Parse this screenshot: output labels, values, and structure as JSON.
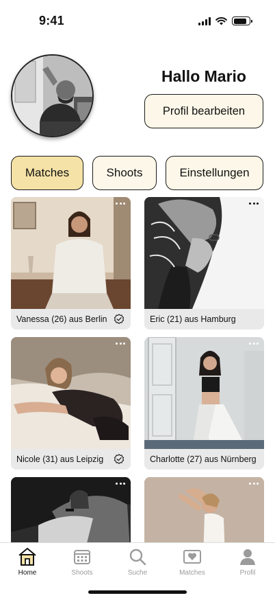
{
  "status_bar": {
    "time": "9:41",
    "battery_level": 0.85
  },
  "profile": {
    "greeting": "Hallo Mario",
    "edit_label": "Profil bearbeiten",
    "avatar_icon": "profile-photo"
  },
  "tabs": [
    {
      "label": "Matches",
      "active": true
    },
    {
      "label": "Shoots",
      "active": false
    },
    {
      "label": "Einstellungen",
      "active": false
    }
  ],
  "cards": [
    {
      "caption": "Vanessa (26) aus Berlin",
      "verified": true,
      "photo": "color"
    },
    {
      "caption": "Eric (21) aus Hamburg",
      "verified": false,
      "photo": "bw"
    },
    {
      "caption": "Nicole (31) aus Leipzig",
      "verified": true,
      "photo": "color"
    },
    {
      "caption": "Charlotte (27) aus Nürnberg",
      "verified": false,
      "photo": "color"
    },
    {
      "caption": "",
      "verified": false,
      "photo": "bw"
    },
    {
      "caption": "",
      "verified": false,
      "photo": "color"
    }
  ],
  "nav": [
    {
      "label": "Home",
      "icon": "home-icon",
      "active": true
    },
    {
      "label": "Shoots",
      "icon": "calendar-icon",
      "active": false
    },
    {
      "label": "Suche",
      "icon": "search-icon",
      "active": false
    },
    {
      "label": "Matches",
      "icon": "heart-icon",
      "active": false
    },
    {
      "label": "Profil",
      "icon": "person-icon",
      "active": false
    }
  ],
  "colors": {
    "accent": "#f5e2a6",
    "button_bg": "#fcf7e8",
    "card_bg": "#e9e9e9",
    "nav_inactive": "#9b9b9b"
  }
}
